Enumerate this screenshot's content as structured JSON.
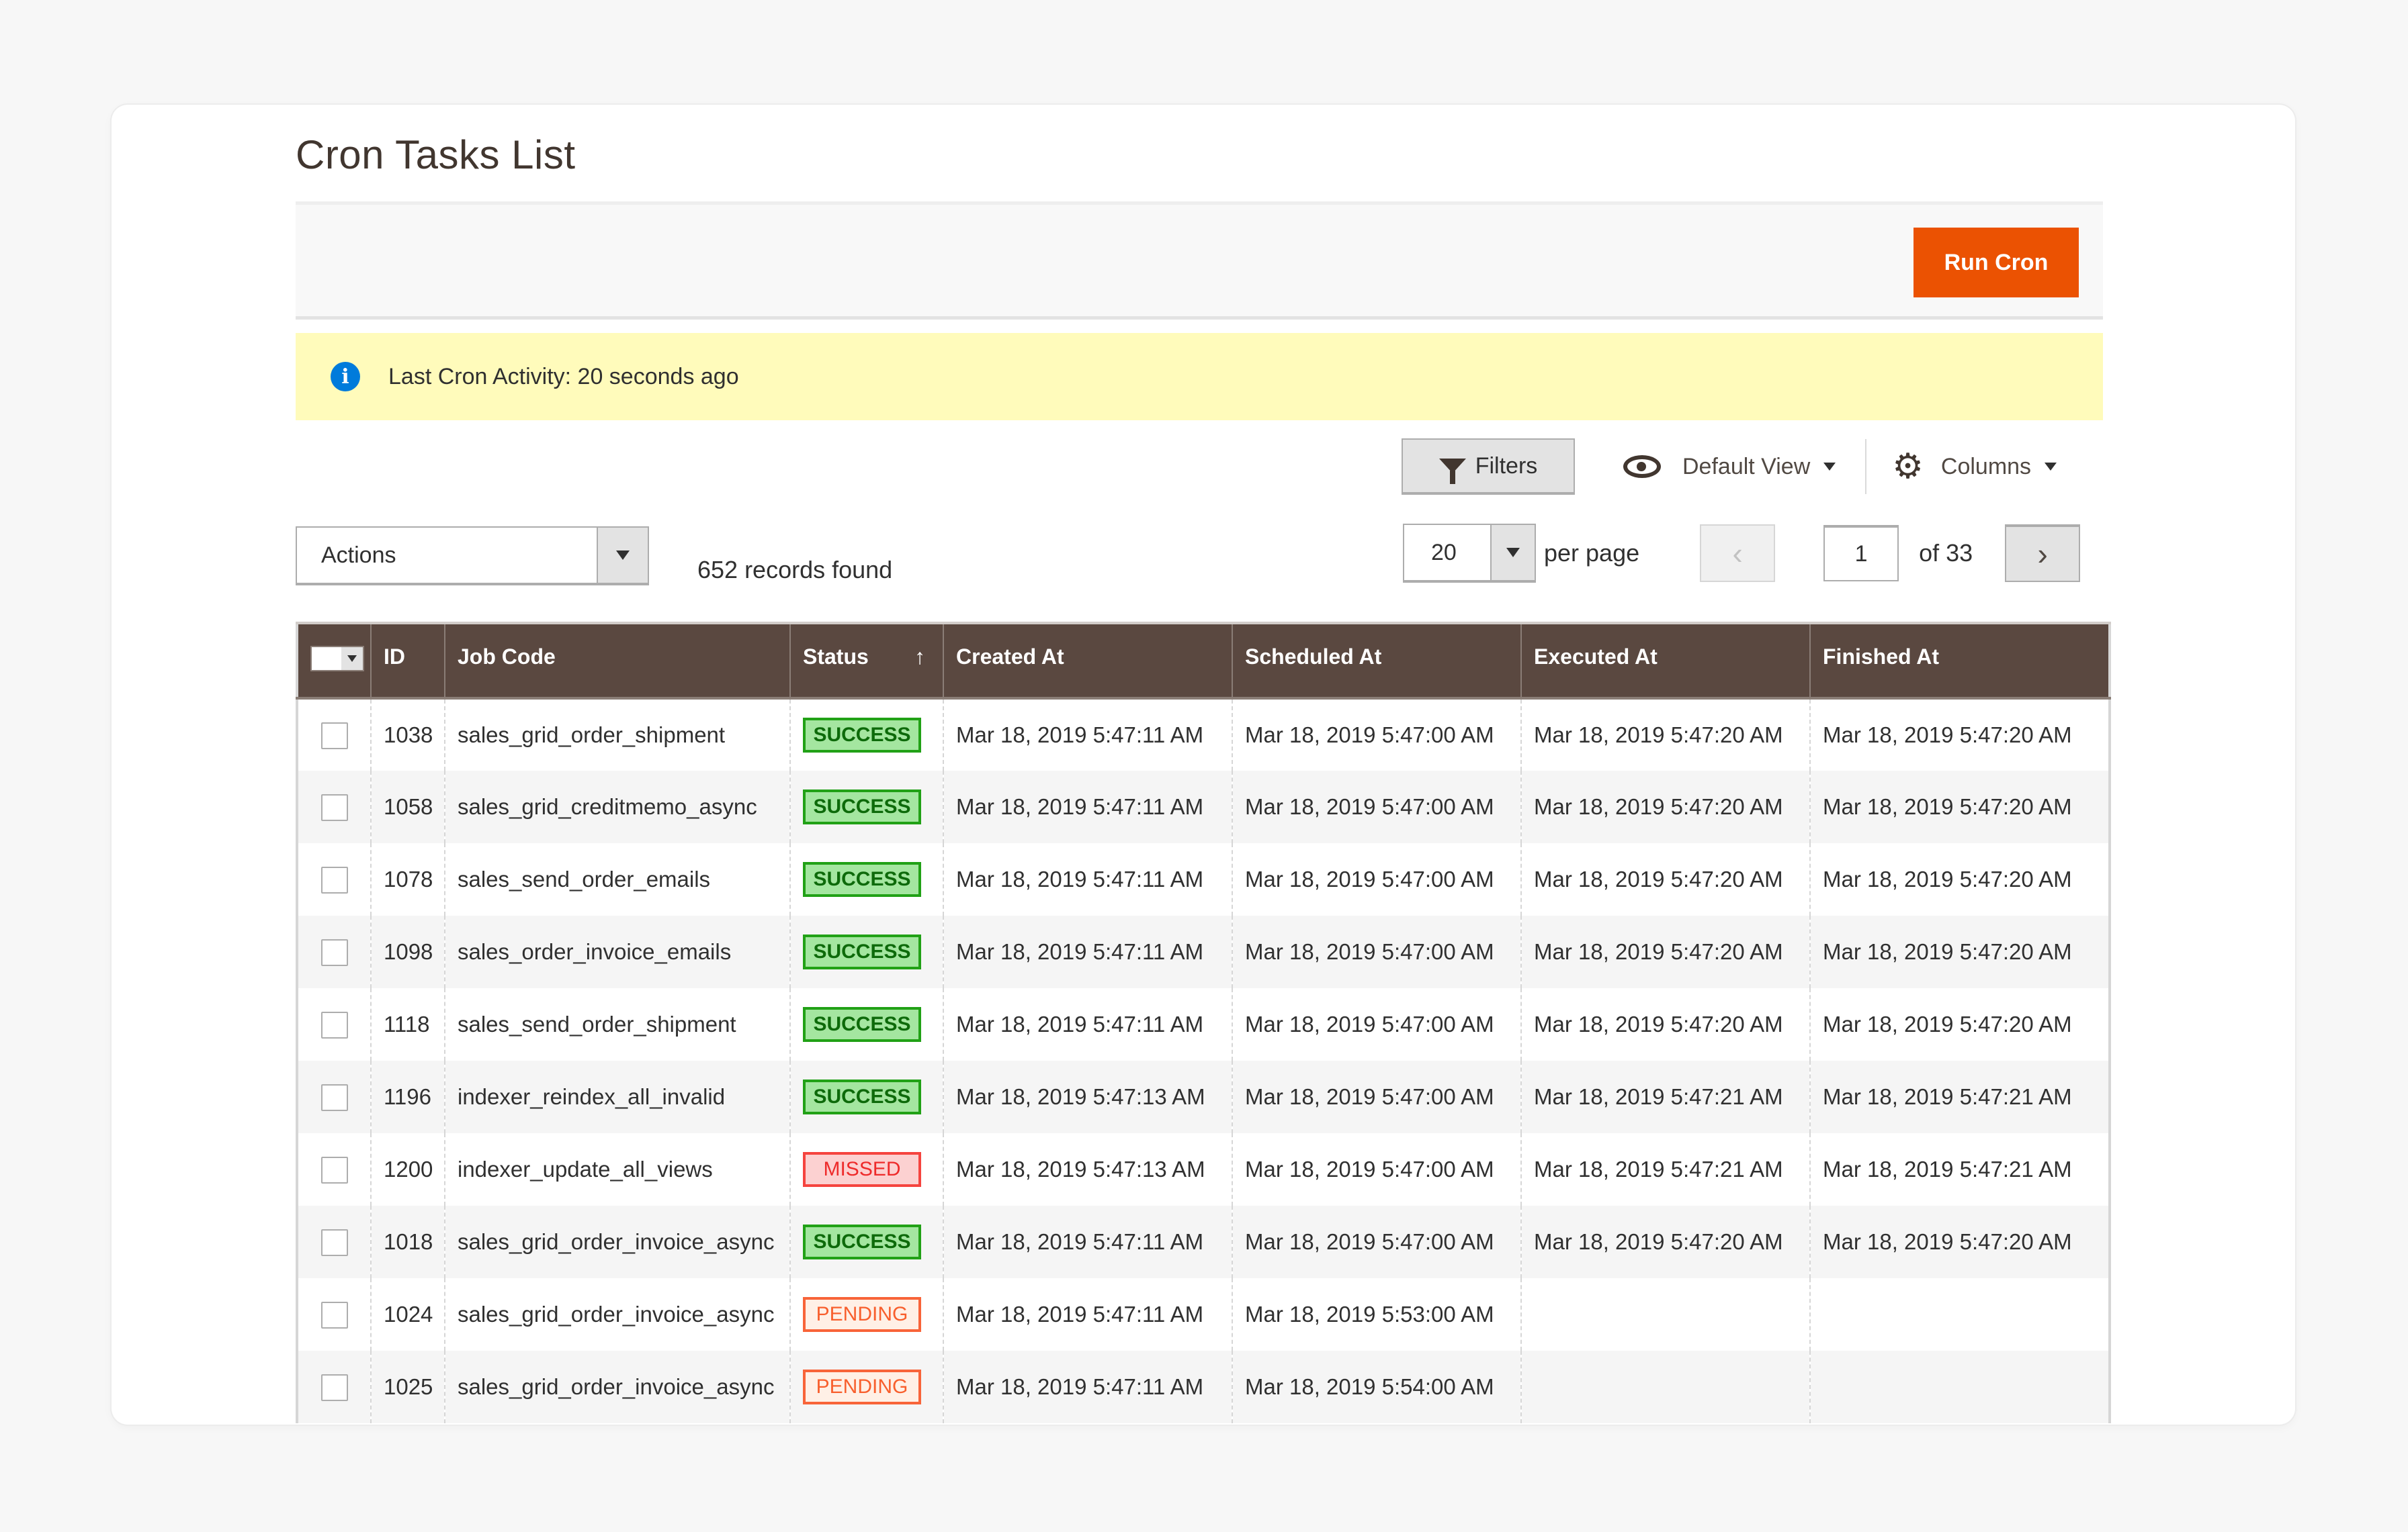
{
  "page": {
    "title": "Cron Tasks List"
  },
  "actions_bar": {
    "run_cron_label": "Run Cron",
    "accent_color": "#eb5202"
  },
  "notice": {
    "icon": "info-icon",
    "icon_glyph": "i",
    "message": "Last Cron Activity: 20 seconds ago"
  },
  "toolbar": {
    "filters_label": "Filters",
    "view_label": "Default View",
    "columns_label": "Columns"
  },
  "mass_actions": {
    "selected": "Actions"
  },
  "records_found": "652 records found",
  "pagination": {
    "per_page_value": "20",
    "per_page_label": "per page",
    "prev_glyph": "‹",
    "next_glyph": "›",
    "current_page": "1",
    "of_pages": "of 33"
  },
  "grid": {
    "columns": [
      "ID",
      "Job Code",
      "Status",
      "Created At",
      "Scheduled At",
      "Executed At",
      "Finished At"
    ],
    "sort_indicator": "↑",
    "rows": [
      {
        "id": "1038",
        "job_code": "sales_grid_order_shipment",
        "status": "SUCCESS",
        "status_type": "success",
        "created_at": "Mar 18, 2019 5:47:11 AM",
        "scheduled_at": "Mar 18, 2019 5:47:00 AM",
        "executed_at": "Mar 18, 2019 5:47:20 AM",
        "finished_at": "Mar 18, 2019 5:47:20 AM"
      },
      {
        "id": "1058",
        "job_code": "sales_grid_creditmemo_async",
        "status": "SUCCESS",
        "status_type": "success",
        "created_at": "Mar 18, 2019 5:47:11 AM",
        "scheduled_at": "Mar 18, 2019 5:47:00 AM",
        "executed_at": "Mar 18, 2019 5:47:20 AM",
        "finished_at": "Mar 18, 2019 5:47:20 AM"
      },
      {
        "id": "1078",
        "job_code": "sales_send_order_emails",
        "status": "SUCCESS",
        "status_type": "success",
        "created_at": "Mar 18, 2019 5:47:11 AM",
        "scheduled_at": "Mar 18, 2019 5:47:00 AM",
        "executed_at": "Mar 18, 2019 5:47:20 AM",
        "finished_at": "Mar 18, 2019 5:47:20 AM"
      },
      {
        "id": "1098",
        "job_code": "sales_order_invoice_emails",
        "status": "SUCCESS",
        "status_type": "success",
        "created_at": "Mar 18, 2019 5:47:11 AM",
        "scheduled_at": "Mar 18, 2019 5:47:00 AM",
        "executed_at": "Mar 18, 2019 5:47:20 AM",
        "finished_at": "Mar 18, 2019 5:47:20 AM"
      },
      {
        "id": "1118",
        "job_code": "sales_send_order_shipment",
        "status": "SUCCESS",
        "status_type": "success",
        "created_at": "Mar 18, 2019 5:47:11 AM",
        "scheduled_at": "Mar 18, 2019 5:47:00 AM",
        "executed_at": "Mar 18, 2019 5:47:20 AM",
        "finished_at": "Mar 18, 2019 5:47:20 AM"
      },
      {
        "id": "1196",
        "job_code": "indexer_reindex_all_invalid",
        "status": "SUCCESS",
        "status_type": "success",
        "created_at": "Mar 18, 2019 5:47:13 AM",
        "scheduled_at": "Mar 18, 2019 5:47:00 AM",
        "executed_at": "Mar 18, 2019 5:47:21 AM",
        "finished_at": "Mar 18, 2019 5:47:21 AM"
      },
      {
        "id": "1200",
        "job_code": "indexer_update_all_views",
        "status": "MISSED",
        "status_type": "missed",
        "created_at": "Mar 18, 2019 5:47:13 AM",
        "scheduled_at": "Mar 18, 2019 5:47:00 AM",
        "executed_at": "Mar 18, 2019 5:47:21 AM",
        "finished_at": "Mar 18, 2019 5:47:21 AM"
      },
      {
        "id": "1018",
        "job_code": "sales_grid_order_invoice_async",
        "status": "SUCCESS",
        "status_type": "success",
        "created_at": "Mar 18, 2019 5:47:11 AM",
        "scheduled_at": "Mar 18, 2019 5:47:00 AM",
        "executed_at": "Mar 18, 2019 5:47:20 AM",
        "finished_at": "Mar 18, 2019 5:47:20 AM"
      },
      {
        "id": "1024",
        "job_code": "sales_grid_order_invoice_async",
        "status": "PENDING",
        "status_type": "pending",
        "created_at": "Mar 18, 2019 5:47:11 AM",
        "scheduled_at": "Mar 18, 2019 5:53:00 AM",
        "executed_at": "",
        "finished_at": ""
      },
      {
        "id": "1025",
        "job_code": "sales_grid_order_invoice_async",
        "status": "PENDING",
        "status_type": "pending",
        "created_at": "Mar 18, 2019 5:47:11 AM",
        "scheduled_at": "Mar 18, 2019 5:54:00 AM",
        "executed_at": "",
        "finished_at": ""
      }
    ]
  }
}
